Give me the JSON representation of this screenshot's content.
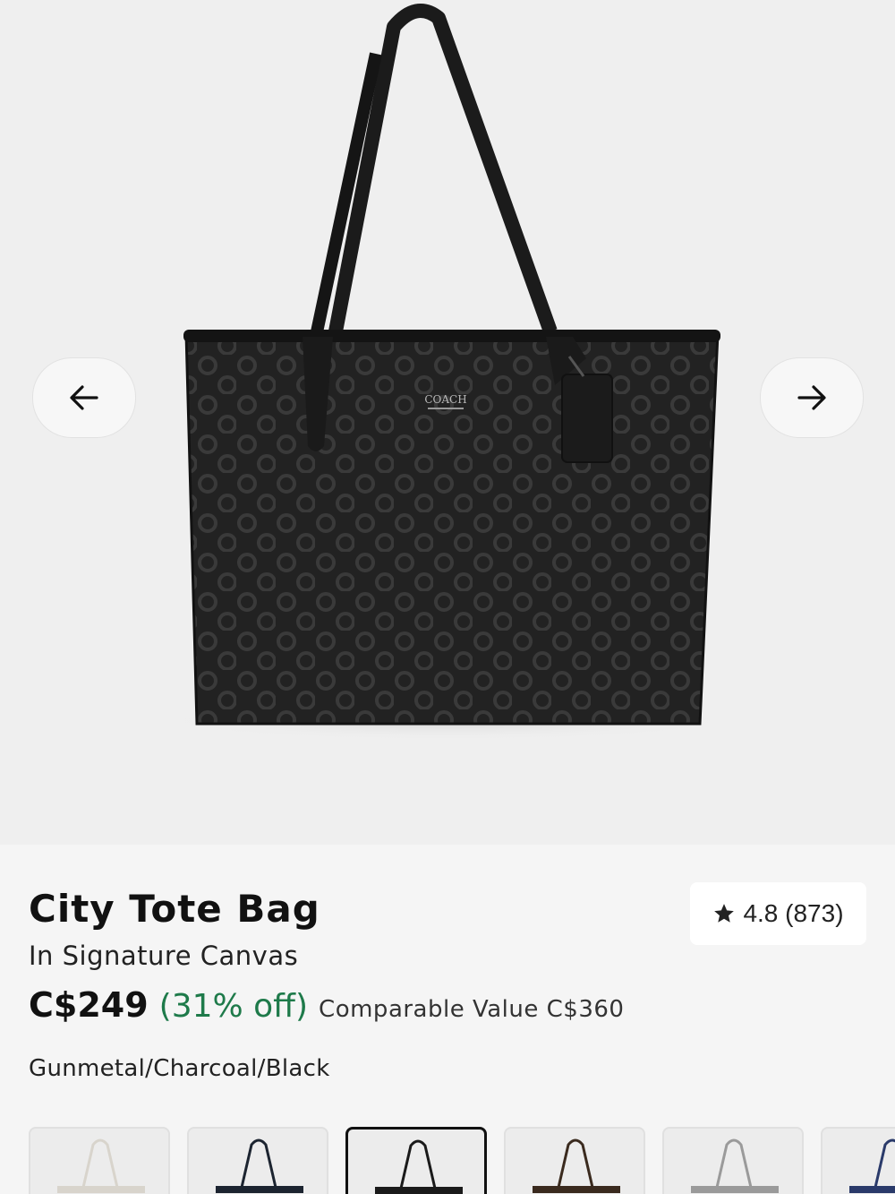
{
  "gallery": {
    "prev_icon": "arrow-left-icon",
    "next_icon": "arrow-right-icon",
    "bag_logo_text": "COACH"
  },
  "product": {
    "title": "City Tote Bag",
    "subtitle": "In Signature Canvas",
    "price": "C$249",
    "discount": "(31% off)",
    "comparable": "Comparable Value C$360",
    "color_name": "Gunmetal/Charcoal/Black"
  },
  "rating": {
    "icon": "star-icon",
    "text": "4.8 (873)"
  },
  "swatches": [
    {
      "name": "swatch-1",
      "handle_color": "#d8d4cc",
      "selected": false
    },
    {
      "name": "swatch-2",
      "handle_color": "#1c2430",
      "selected": false
    },
    {
      "name": "swatch-3",
      "handle_color": "#1a1a1a",
      "selected": true
    },
    {
      "name": "swatch-4",
      "handle_color": "#3a2a1e",
      "selected": false
    },
    {
      "name": "swatch-5",
      "handle_color": "#9a9a9a",
      "selected": false
    },
    {
      "name": "swatch-6",
      "handle_color": "#2a3a6a",
      "selected": false
    }
  ],
  "colors": {
    "discount_green": "#1e7a4a",
    "background": "#f5f5f5",
    "hero_background": "#efefef"
  }
}
